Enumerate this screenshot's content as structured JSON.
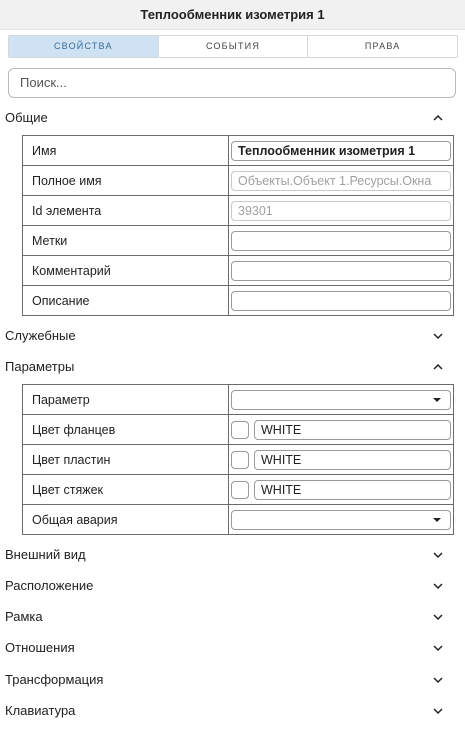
{
  "window": {
    "title": "Теплообменник изометрия 1"
  },
  "tabs": [
    {
      "label": "СВОЙСТВА",
      "active": true
    },
    {
      "label": "СОБЫТИЯ",
      "active": false
    },
    {
      "label": "ПРАВА",
      "active": false
    }
  ],
  "search": {
    "placeholder": "Поиск..."
  },
  "sections": {
    "general": {
      "title": "Общие",
      "expanded": true,
      "rows": {
        "name": {
          "label": "Имя",
          "value": "Теплообменник изометрия 1"
        },
        "full_name": {
          "label": "Полное имя",
          "value": "Объекты.Объект 1.Ресурсы.Окна"
        },
        "element_id": {
          "label": "Id элемента",
          "value": "39301"
        },
        "tags": {
          "label": "Метки",
          "value": ""
        },
        "comment": {
          "label": "Комментарий",
          "value": ""
        },
        "description": {
          "label": "Описание",
          "value": ""
        }
      }
    },
    "service": {
      "title": "Служебные",
      "expanded": false
    },
    "params": {
      "title": "Параметры",
      "expanded": true,
      "rows": {
        "parameter": {
          "label": "Параметр",
          "value": ""
        },
        "flange_color": {
          "label": "Цвет фланцев",
          "value": "WHITE"
        },
        "plate_color": {
          "label": "Цвет пластин",
          "value": "WHITE"
        },
        "tie_color": {
          "label": "Цвет стяжек",
          "value": "WHITE"
        },
        "general_alarm": {
          "label": "Общая авария",
          "value": ""
        }
      }
    },
    "appearance": {
      "title": "Внешний вид",
      "expanded": false
    },
    "position": {
      "title": "Расположение",
      "expanded": false
    },
    "frame": {
      "title": "Рамка",
      "expanded": false
    },
    "relations": {
      "title": "Отношения",
      "expanded": false
    },
    "transform": {
      "title": "Трансформация",
      "expanded": false
    },
    "keyboard": {
      "title": "Клавиатура",
      "expanded": false
    }
  },
  "icons": {
    "expanded": "chevron-up-icon",
    "collapsed": "chevron-down-icon"
  },
  "colors": {
    "active_tab_bg": "#cfe2f3",
    "active_tab_text": "#3a6a96"
  }
}
